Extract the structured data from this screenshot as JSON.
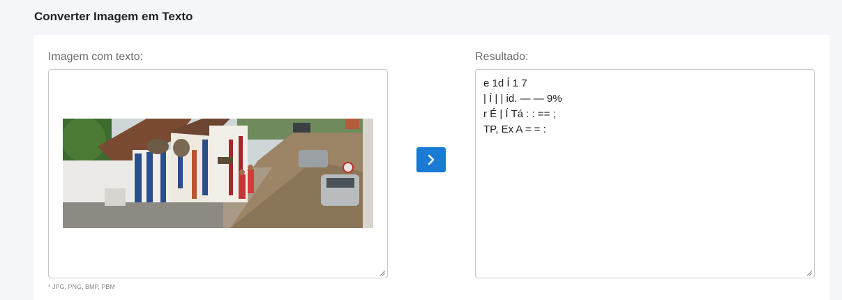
{
  "page": {
    "title": "Converter Imagem em Texto"
  },
  "input": {
    "label": "Imagem com texto:",
    "hint": "* JPG, PNG, BMP, PBM"
  },
  "output": {
    "label": "Resultado:",
    "lines": [
      "e 1d Í 1 7",
      "| Í | | id. — — 9%",
      "r É | Í Tá : : == ;",
      "TP, Ex A = = :"
    ]
  },
  "colors": {
    "accent": "#1a7bd4",
    "background": "#f5f6f9"
  },
  "icons": {
    "convert": "chevron-right-icon"
  }
}
